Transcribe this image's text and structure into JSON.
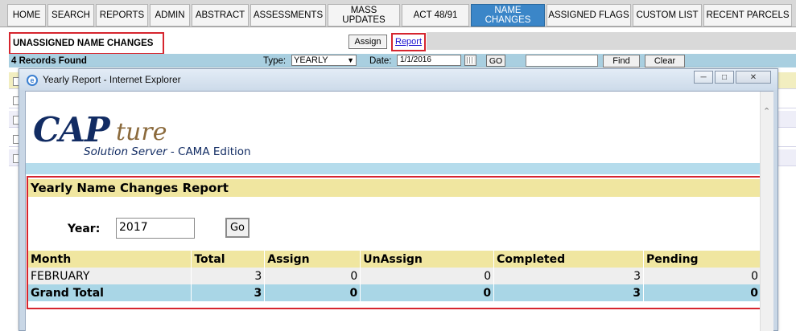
{
  "nav": {
    "tabs": [
      {
        "label": "HOME"
      },
      {
        "label": "SEARCH"
      },
      {
        "label": "REPORTS"
      },
      {
        "label": "ADMIN"
      },
      {
        "label": "ABSTRACT"
      },
      {
        "label": "ASSESSMENTS"
      },
      {
        "label": "MASS UPDATES"
      },
      {
        "label": "ACT 48/91"
      },
      {
        "label": "NAME CHANGES",
        "active": true
      },
      {
        "label": "ASSIGNED FLAGS"
      },
      {
        "label": "CUSTOM LIST"
      },
      {
        "label": "RECENT PARCELS"
      }
    ]
  },
  "page": {
    "title": "UNASSIGNED NAME CHANGES",
    "assign_label": "Assign",
    "report_label": "Report",
    "records_found": "4 Records Found",
    "type_label": "Type:",
    "type_value": "YEARLY",
    "date_label": "Date:",
    "date_value": "1/1/2016",
    "go_label": "GO",
    "search_value": "",
    "find_label": "Find",
    "clear_label": "Clear"
  },
  "popup": {
    "window_title": "Yearly Report - Internet Explorer",
    "logo_main": "CAP",
    "logo_script": "ture",
    "logo_subtitle": "Solution Server",
    "logo_edition": " - CAMA Edition",
    "report_heading": "Yearly Name Changes Report",
    "year_label": "Year:",
    "year_value": "2017",
    "go_label": "Go",
    "table": {
      "columns": [
        "Month",
        "Total",
        "Assign",
        "UnAssign",
        "Completed",
        "Pending"
      ],
      "rows": [
        [
          "FEBRUARY",
          "3",
          "0",
          "0",
          "3",
          "0"
        ]
      ],
      "grand_total": [
        "Grand Total",
        "3",
        "0",
        "0",
        "3",
        "0"
      ]
    }
  },
  "colors": {
    "accent_red": "#d6252e",
    "nav_active": "#3b86c8",
    "header_yellow": "#f0e6a0",
    "total_blue": "#a9d6e6"
  }
}
